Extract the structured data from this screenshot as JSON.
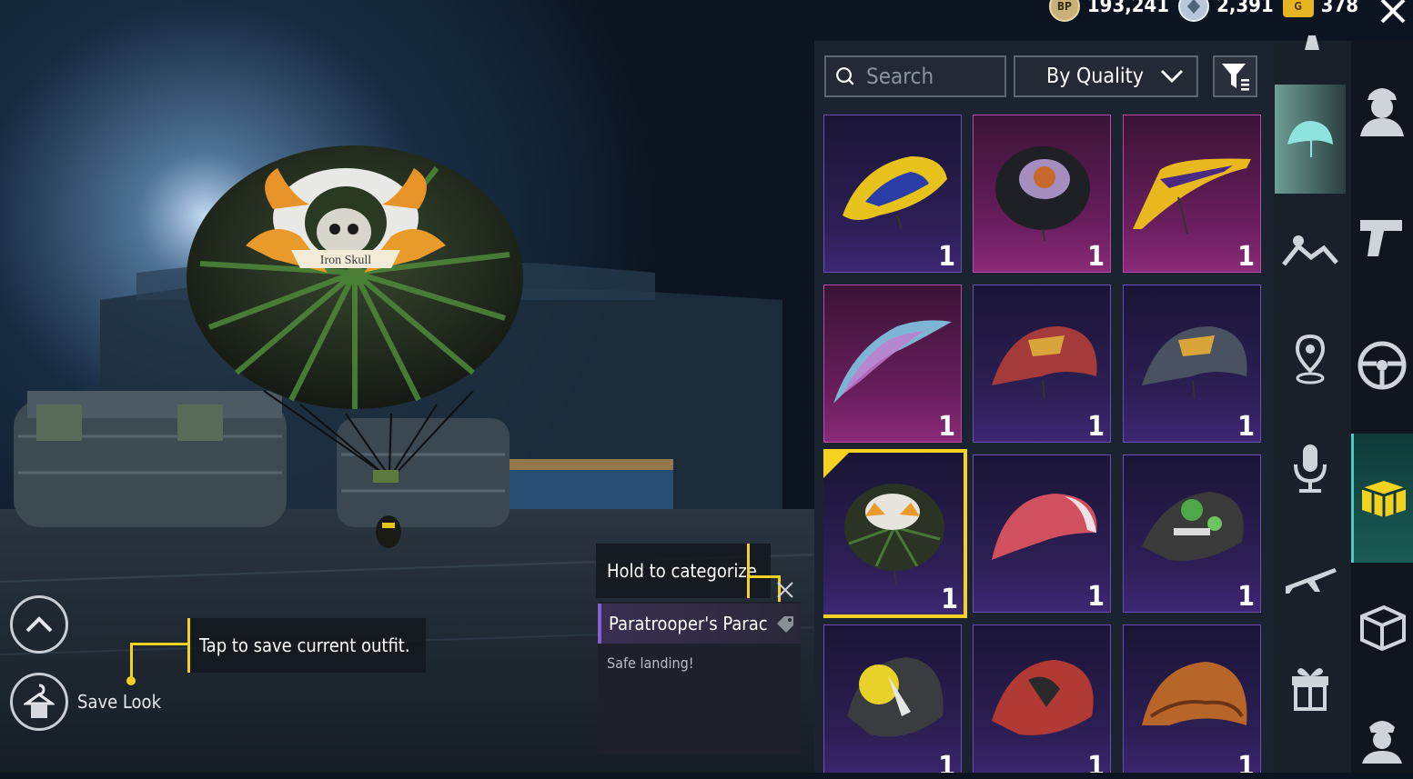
{
  "currency": {
    "bp": {
      "icon": "BP",
      "value": "193,241"
    },
    "uc": {
      "icon": "uc-icon",
      "value": "2,391"
    },
    "g": {
      "icon": "G",
      "value": "378"
    }
  },
  "toolbar": {
    "search_placeholder": "Search",
    "sort_label": "By Quality"
  },
  "items": [
    {
      "name": "yellow-blue-glider",
      "qty": "1",
      "quality": "purple"
    },
    {
      "name": "dark-emblem-parachute",
      "qty": "1",
      "quality": "pink"
    },
    {
      "name": "gold-delta-glider",
      "qty": "1",
      "quality": "pink"
    },
    {
      "name": "iridescent-wing-glider",
      "qty": "1",
      "quality": "pink"
    },
    {
      "name": "red-emblem-parachute",
      "qty": "1",
      "quality": "purple"
    },
    {
      "name": "grey-emblem-parachute",
      "qty": "1",
      "quality": "purple"
    },
    {
      "name": "iron-skull-parachute",
      "qty": "1",
      "quality": "purple",
      "selected": true
    },
    {
      "name": "pink-parachute",
      "qty": "1",
      "quality": "purple"
    },
    {
      "name": "graffiti-parachute",
      "qty": "1",
      "quality": "purple"
    },
    {
      "name": "moon-parachute",
      "qty": "1",
      "quality": "purple"
    },
    {
      "name": "red-black-parachute",
      "qty": "1",
      "quality": "purple"
    },
    {
      "name": "orange-parachute",
      "qty": "1",
      "quality": "purple"
    }
  ],
  "rail": [
    "parachute-icon",
    "emote-icon",
    "location-icon",
    "microphone-icon",
    "airplane-icon",
    "gift-icon"
  ],
  "rail2": [
    "avatar-icon",
    "gun-icon",
    "steering-wheel-icon",
    "crate-icon",
    "box-icon",
    "character-icon"
  ],
  "hints": {
    "categorize": "Hold to categorize",
    "save_outfit": "Tap to save current outfit."
  },
  "selected_item": {
    "title": "Paratrooper's Parac",
    "description": "Safe landing!"
  },
  "preview": {
    "logo_text": "Iron Skull"
  },
  "buttons": {
    "save_look": "Save Look"
  }
}
